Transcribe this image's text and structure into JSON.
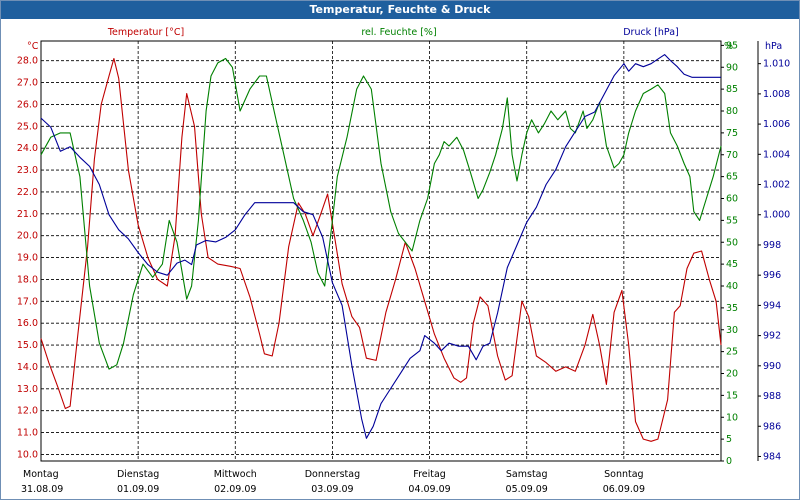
{
  "window": {
    "title": "Temperatur, Feuchte & Druck"
  },
  "colors": {
    "temperature": "#c00000",
    "humidity": "#008000",
    "pressure": "#000099",
    "grid": "#000000"
  },
  "chart_data": {
    "type": "line",
    "grid": true,
    "x_range": [
      0,
      7
    ],
    "x_tick_labels": [
      {
        "x": 0,
        "day": "Montag",
        "date": "31.08.09"
      },
      {
        "x": 1,
        "day": "Dienstag",
        "date": "01.09.09"
      },
      {
        "x": 2,
        "day": "Mittwoch",
        "date": "02.09.09"
      },
      {
        "x": 3,
        "day": "Donnerstag",
        "date": "03.09.09"
      },
      {
        "x": 4,
        "day": "Freitag",
        "date": "04.09.09"
      },
      {
        "x": 5,
        "day": "Samstag",
        "date": "05.09.09"
      },
      {
        "x": 6,
        "day": "Sonntag",
        "date": "06.09.09"
      }
    ],
    "axes": {
      "temperature": {
        "unit": "°C",
        "range": [
          9.7,
          28.9
        ],
        "ticks": [
          "10.0",
          "11.0",
          "12.0",
          "13.0",
          "14.0",
          "15.0",
          "16.0",
          "17.0",
          "18.0",
          "19.0",
          "20.0",
          "21.0",
          "22.0",
          "23.0",
          "24.0",
          "25.0",
          "26.0",
          "27.0",
          "28.0"
        ]
      },
      "humidity": {
        "unit": "%",
        "range": [
          0,
          96
        ],
        "ticks": [
          "0",
          "5",
          "10",
          "15",
          "20",
          "25",
          "30",
          "35",
          "40",
          "45",
          "50",
          "55",
          "60",
          "65",
          "70",
          "75",
          "80",
          "85",
          "90",
          "95"
        ]
      },
      "pressure": {
        "unit": "hPa",
        "range": [
          983.7,
          1011.5
        ],
        "ticks": [
          "984",
          "986",
          "988",
          "990",
          "992",
          "994",
          "996",
          "998",
          "1.000",
          "1.002",
          "1.004",
          "1.006",
          "1.008",
          "1.010"
        ]
      }
    },
    "series": [
      {
        "name": "Temperatur [°C]",
        "axis": "temperature",
        "points": [
          [
            0,
            15.3
          ],
          [
            0.08,
            14.2
          ],
          [
            0.18,
            13.0
          ],
          [
            0.25,
            12.1
          ],
          [
            0.3,
            12.2
          ],
          [
            0.38,
            15.5
          ],
          [
            0.48,
            19.5
          ],
          [
            0.55,
            23.5
          ],
          [
            0.62,
            26.0
          ],
          [
            0.7,
            27.3
          ],
          [
            0.75,
            28.1
          ],
          [
            0.8,
            27.2
          ],
          [
            0.9,
            23.0
          ],
          [
            1.0,
            20.5
          ],
          [
            1.1,
            19.0
          ],
          [
            1.2,
            18.0
          ],
          [
            1.3,
            17.7
          ],
          [
            1.38,
            20.0
          ],
          [
            1.45,
            24.5
          ],
          [
            1.5,
            26.5
          ],
          [
            1.58,
            25.0
          ],
          [
            1.65,
            21.0
          ],
          [
            1.72,
            19.0
          ],
          [
            1.82,
            18.7
          ],
          [
            1.95,
            18.6
          ],
          [
            2.05,
            18.5
          ],
          [
            2.15,
            17.2
          ],
          [
            2.25,
            15.5
          ],
          [
            2.3,
            14.6
          ],
          [
            2.38,
            14.5
          ],
          [
            2.45,
            16.0
          ],
          [
            2.55,
            19.5
          ],
          [
            2.65,
            21.5
          ],
          [
            2.72,
            21.0
          ],
          [
            2.8,
            20.0
          ],
          [
            2.88,
            21.0
          ],
          [
            2.95,
            21.9
          ],
          [
            3.02,
            20.0
          ],
          [
            3.1,
            17.8
          ],
          [
            3.2,
            16.3
          ],
          [
            3.28,
            15.8
          ],
          [
            3.35,
            14.4
          ],
          [
            3.45,
            14.3
          ],
          [
            3.55,
            16.5
          ],
          [
            3.65,
            18.0
          ],
          [
            3.75,
            19.7
          ],
          [
            3.85,
            18.5
          ],
          [
            3.95,
            17.0
          ],
          [
            4.05,
            15.5
          ],
          [
            4.15,
            14.4
          ],
          [
            4.25,
            13.5
          ],
          [
            4.32,
            13.3
          ],
          [
            4.38,
            13.5
          ],
          [
            4.45,
            16.0
          ],
          [
            4.52,
            17.2
          ],
          [
            4.6,
            16.8
          ],
          [
            4.7,
            14.5
          ],
          [
            4.78,
            13.4
          ],
          [
            4.85,
            13.6
          ],
          [
            4.95,
            17.0
          ],
          [
            5.02,
            16.3
          ],
          [
            5.1,
            14.5
          ],
          [
            5.2,
            14.2
          ],
          [
            5.3,
            13.8
          ],
          [
            5.4,
            14.0
          ],
          [
            5.5,
            13.8
          ],
          [
            5.6,
            15.0
          ],
          [
            5.68,
            16.4
          ],
          [
            5.75,
            15.0
          ],
          [
            5.82,
            13.2
          ],
          [
            5.9,
            16.5
          ],
          [
            5.98,
            17.5
          ],
          [
            6.05,
            15.0
          ],
          [
            6.12,
            11.5
          ],
          [
            6.2,
            10.7
          ],
          [
            6.28,
            10.6
          ],
          [
            6.35,
            10.7
          ],
          [
            6.45,
            12.5
          ],
          [
            6.52,
            16.5
          ],
          [
            6.58,
            16.8
          ],
          [
            6.65,
            18.5
          ],
          [
            6.72,
            19.2
          ],
          [
            6.8,
            19.3
          ],
          [
            6.88,
            18.0
          ],
          [
            6.95,
            17.0
          ],
          [
            7.0,
            15.0
          ]
        ]
      },
      {
        "name": "rel. Feuchte [%]",
        "axis": "humidity",
        "points": [
          [
            0,
            70
          ],
          [
            0.1,
            74
          ],
          [
            0.2,
            75
          ],
          [
            0.3,
            75
          ],
          [
            0.4,
            65
          ],
          [
            0.5,
            40
          ],
          [
            0.6,
            27
          ],
          [
            0.7,
            21
          ],
          [
            0.78,
            22
          ],
          [
            0.85,
            27
          ],
          [
            0.95,
            38
          ],
          [
            1.05,
            45
          ],
          [
            1.15,
            42
          ],
          [
            1.25,
            45
          ],
          [
            1.32,
            55
          ],
          [
            1.4,
            50
          ],
          [
            1.5,
            37
          ],
          [
            1.55,
            40
          ],
          [
            1.62,
            55
          ],
          [
            1.7,
            80
          ],
          [
            1.75,
            88
          ],
          [
            1.82,
            91
          ],
          [
            1.9,
            92
          ],
          [
            1.97,
            90
          ],
          [
            2.05,
            80
          ],
          [
            2.15,
            85
          ],
          [
            2.25,
            88
          ],
          [
            2.32,
            88
          ],
          [
            2.4,
            80
          ],
          [
            2.5,
            70
          ],
          [
            2.6,
            60
          ],
          [
            2.7,
            55
          ],
          [
            2.78,
            50
          ],
          [
            2.85,
            43
          ],
          [
            2.92,
            40
          ],
          [
            3.0,
            55
          ],
          [
            3.05,
            65
          ],
          [
            3.15,
            74
          ],
          [
            3.25,
            85
          ],
          [
            3.32,
            88
          ],
          [
            3.4,
            85
          ],
          [
            3.5,
            68
          ],
          [
            3.6,
            57
          ],
          [
            3.68,
            52
          ],
          [
            3.75,
            50
          ],
          [
            3.82,
            48
          ],
          [
            3.9,
            55
          ],
          [
            3.98,
            60
          ],
          [
            4.05,
            68
          ],
          [
            4.1,
            70
          ],
          [
            4.15,
            73
          ],
          [
            4.2,
            72
          ],
          [
            4.28,
            74
          ],
          [
            4.35,
            71
          ],
          [
            4.42,
            66
          ],
          [
            4.5,
            60
          ],
          [
            4.55,
            62
          ],
          [
            4.62,
            66
          ],
          [
            4.68,
            70
          ],
          [
            4.75,
            76
          ],
          [
            4.8,
            83
          ],
          [
            4.85,
            70
          ],
          [
            4.9,
            64
          ],
          [
            4.95,
            70
          ],
          [
            5.0,
            75
          ],
          [
            5.05,
            78
          ],
          [
            5.12,
            75
          ],
          [
            5.18,
            77
          ],
          [
            5.25,
            80
          ],
          [
            5.32,
            78
          ],
          [
            5.4,
            80
          ],
          [
            5.45,
            76
          ],
          [
            5.5,
            75
          ],
          [
            5.58,
            80
          ],
          [
            5.62,
            76
          ],
          [
            5.68,
            78
          ],
          [
            5.75,
            82
          ],
          [
            5.82,
            72
          ],
          [
            5.9,
            67
          ],
          [
            5.95,
            68
          ],
          [
            6.0,
            70
          ],
          [
            6.05,
            75
          ],
          [
            6.12,
            80
          ],
          [
            6.2,
            84
          ],
          [
            6.28,
            85
          ],
          [
            6.35,
            86
          ],
          [
            6.42,
            84
          ],
          [
            6.48,
            75
          ],
          [
            6.55,
            72
          ],
          [
            6.62,
            68
          ],
          [
            6.68,
            65
          ],
          [
            6.72,
            57
          ],
          [
            6.78,
            55
          ],
          [
            6.85,
            60
          ],
          [
            6.92,
            65
          ],
          [
            7.0,
            72
          ]
        ]
      },
      {
        "name": "Druck [hPa]",
        "axis": "pressure",
        "points": [
          [
            0,
            1006.4
          ],
          [
            0.1,
            1005.8
          ],
          [
            0.2,
            1004.2
          ],
          [
            0.3,
            1004.5
          ],
          [
            0.4,
            1003.8
          ],
          [
            0.5,
            1003.2
          ],
          [
            0.6,
            1002.0
          ],
          [
            0.7,
            1000.0
          ],
          [
            0.8,
            999.0
          ],
          [
            0.9,
            998.4
          ],
          [
            1.0,
            997.5
          ],
          [
            1.1,
            996.7
          ],
          [
            1.2,
            996.2
          ],
          [
            1.3,
            996.0
          ],
          [
            1.4,
            996.8
          ],
          [
            1.48,
            997.0
          ],
          [
            1.55,
            996.7
          ],
          [
            1.6,
            998.0
          ],
          [
            1.7,
            998.3
          ],
          [
            1.8,
            998.2
          ],
          [
            1.9,
            998.5
          ],
          [
            2.0,
            999.0
          ],
          [
            2.1,
            1000.0
          ],
          [
            2.2,
            1000.8
          ],
          [
            2.3,
            1000.8
          ],
          [
            2.4,
            1000.8
          ],
          [
            2.5,
            1000.8
          ],
          [
            2.6,
            1000.8
          ],
          [
            2.7,
            1000.2
          ],
          [
            2.8,
            1000.0
          ],
          [
            2.9,
            998.5
          ],
          [
            3.0,
            995.5
          ],
          [
            3.1,
            994.0
          ],
          [
            3.2,
            990.0
          ],
          [
            3.3,
            986.5
          ],
          [
            3.35,
            985.2
          ],
          [
            3.42,
            986.0
          ],
          [
            3.5,
            987.5
          ],
          [
            3.6,
            988.5
          ],
          [
            3.7,
            989.5
          ],
          [
            3.8,
            990.5
          ],
          [
            3.9,
            991.0
          ],
          [
            3.95,
            992.0
          ],
          [
            4.05,
            991.5
          ],
          [
            4.12,
            991.0
          ],
          [
            4.2,
            991.5
          ],
          [
            4.3,
            991.3
          ],
          [
            4.4,
            991.3
          ],
          [
            4.48,
            990.4
          ],
          [
            4.55,
            991.3
          ],
          [
            4.62,
            991.5
          ],
          [
            4.7,
            993.5
          ],
          [
            4.8,
            996.5
          ],
          [
            4.9,
            998.0
          ],
          [
            5.0,
            999.5
          ],
          [
            5.1,
            1000.5
          ],
          [
            5.2,
            1002.0
          ],
          [
            5.3,
            1003.0
          ],
          [
            5.4,
            1004.5
          ],
          [
            5.5,
            1005.5
          ],
          [
            5.6,
            1006.5
          ],
          [
            5.7,
            1006.8
          ],
          [
            5.8,
            1008.0
          ],
          [
            5.9,
            1009.2
          ],
          [
            6.0,
            1010.0
          ],
          [
            6.05,
            1009.5
          ],
          [
            6.12,
            1010.0
          ],
          [
            6.2,
            1009.8
          ],
          [
            6.28,
            1010.0
          ],
          [
            6.35,
            1010.3
          ],
          [
            6.42,
            1010.6
          ],
          [
            6.48,
            1010.2
          ],
          [
            6.55,
            1009.8
          ],
          [
            6.62,
            1009.3
          ],
          [
            6.7,
            1009.1
          ],
          [
            6.8,
            1009.1
          ],
          [
            6.9,
            1009.1
          ],
          [
            7.0,
            1009.1
          ]
        ]
      }
    ]
  }
}
